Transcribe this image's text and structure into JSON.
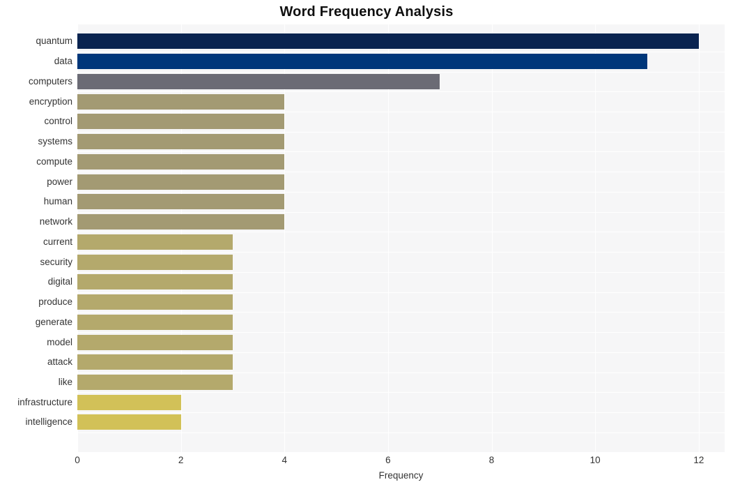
{
  "chart_data": {
    "type": "bar",
    "orientation": "horizontal",
    "title": "Word Frequency Analysis",
    "xlabel": "Frequency",
    "ylabel": "",
    "xlim": [
      0,
      12.5
    ],
    "xticks": [
      0,
      2,
      4,
      6,
      8,
      10,
      12
    ],
    "xtick_labels": [
      "0",
      "2",
      "4",
      "6",
      "8",
      "10",
      "12"
    ],
    "grid": true,
    "legend": null,
    "categories": [
      "quantum",
      "data",
      "computers",
      "encryption",
      "control",
      "systems",
      "compute",
      "power",
      "human",
      "network",
      "current",
      "security",
      "digital",
      "produce",
      "generate",
      "model",
      "attack",
      "like",
      "infrastructure",
      "intelligence"
    ],
    "values": [
      12,
      11,
      7,
      4,
      4,
      4,
      4,
      4,
      4,
      4,
      3,
      3,
      3,
      3,
      3,
      3,
      3,
      3,
      2,
      2
    ],
    "bar_colors": [
      "#0a2450",
      "#00377a",
      "#6b6b75",
      "#a39a73",
      "#a39a73",
      "#a39a73",
      "#a39a73",
      "#a39a73",
      "#a39a73",
      "#a39a73",
      "#b4a96c",
      "#b4a96c",
      "#b4a96c",
      "#b4a96c",
      "#b4a96c",
      "#b4a96c",
      "#b4a96c",
      "#b4a96c",
      "#d2c158",
      "#d2c158"
    ]
  },
  "style": {
    "plot_background": "#f6f6f7",
    "gridline_color": "#ffffff",
    "page_background": "#ffffff",
    "text_color": "#333333",
    "title_color": "#0f0f0f"
  }
}
